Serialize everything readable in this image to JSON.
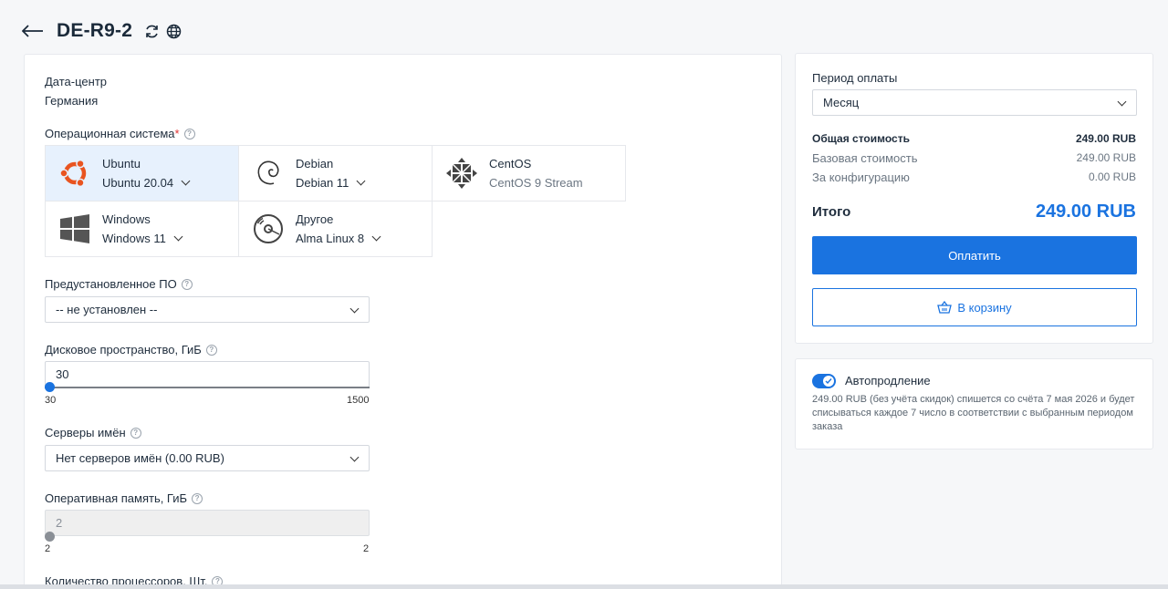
{
  "header": {
    "title": "DE-R9-2"
  },
  "config": {
    "datacenter_label": "Дата-центр",
    "datacenter_value": "Германия",
    "os_label": "Операционная система",
    "os_required": "*",
    "os_options": [
      {
        "name": "Ubuntu",
        "version": "Ubuntu 20.04",
        "icon": "ubuntu-logo-icon"
      },
      {
        "name": "Debian",
        "version": "Debian 11",
        "icon": "debian-logo-icon"
      },
      {
        "name": "CentOS",
        "version": "CentOS 9 Stream",
        "icon": "centos-logo-icon"
      },
      {
        "name": "Windows",
        "version": "Windows 11",
        "icon": "windows-logo-icon"
      },
      {
        "name": "Другое",
        "version": "Alma Linux 8",
        "icon": "disc-icon"
      }
    ],
    "preinstalled_label": "Предустановленное ПО",
    "preinstalled_value": "-- не установлен --",
    "disk_label": "Дисковое пространство, ГиБ",
    "disk_value": "30",
    "disk_min": "30",
    "disk_max": "1500",
    "ns_label": "Серверы имён",
    "ns_value": "Нет серверов имён (0.00 RUB)",
    "ram_label": "Оперативная память, ГиБ",
    "ram_value": "2",
    "ram_min": "2",
    "ram_max": "2",
    "cpu_label": "Количество процессоров, Шт."
  },
  "summary": {
    "period_label": "Период оплаты",
    "period_value": "Месяц",
    "total_cost_label": "Общая стоимость",
    "total_cost_value": "249.00 RUB",
    "base_cost_label": "Базовая стоимость",
    "base_cost_value": "249.00 RUB",
    "config_cost_label": "За конфигурацию",
    "config_cost_value": "0.00 RUB",
    "final_label": "Итого",
    "final_value": "249.00 RUB",
    "pay_button": "Оплатить",
    "cart_button": "В корзину"
  },
  "autorenew": {
    "label": "Автопродление",
    "enabled": true,
    "note": "249.00 RUB (без учёта скидок) спишется со счёта 7 мая 2026 и будет списываться каждое 7 число в соответствии с выбранным периодом заказа"
  },
  "colors": {
    "accent": "#1a73e0",
    "selected_tile": "#e7f1fd"
  }
}
